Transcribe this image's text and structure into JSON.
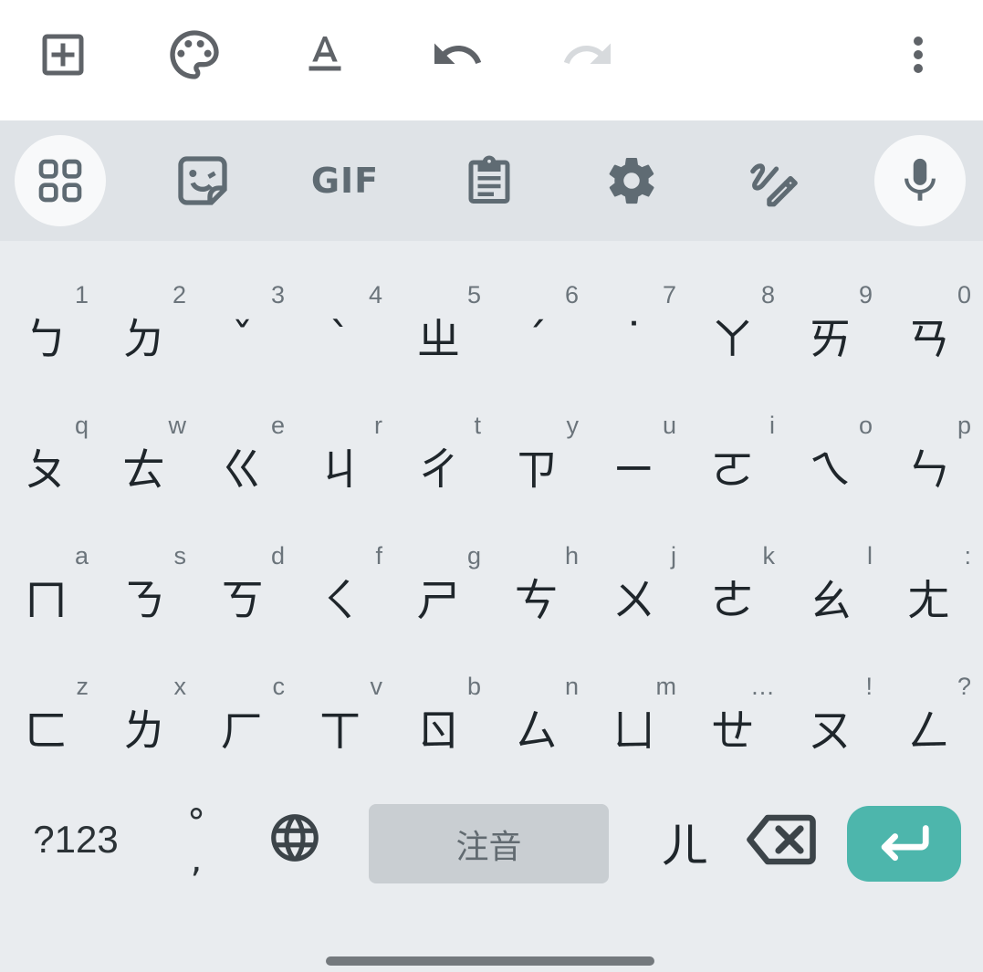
{
  "toolbar": {
    "icons": [
      "add-box-icon",
      "palette-icon",
      "text-format-icon",
      "undo-icon",
      "redo-icon",
      "more-vert-icon"
    ]
  },
  "keyboard_toolbar": {
    "gif_label": "GIF",
    "icons": [
      "apps-grid-icon",
      "sticker-icon",
      "gif-icon",
      "clipboard-icon",
      "settings-gear-icon",
      "handwriting-icon",
      "microphone-icon"
    ]
  },
  "rows": [
    [
      {
        "hint": "1",
        "glyph": "ㄅ"
      },
      {
        "hint": "2",
        "glyph": "ㄉ"
      },
      {
        "hint": "3",
        "glyph": "ˇ"
      },
      {
        "hint": "4",
        "glyph": "ˋ"
      },
      {
        "hint": "5",
        "glyph": "ㄓ"
      },
      {
        "hint": "6",
        "glyph": "ˊ"
      },
      {
        "hint": "7",
        "glyph": "˙"
      },
      {
        "hint": "8",
        "glyph": "ㄚ"
      },
      {
        "hint": "9",
        "glyph": "ㄞ"
      },
      {
        "hint": "0",
        "glyph": "ㄢ"
      }
    ],
    [
      {
        "hint": "q",
        "glyph": "ㄆ"
      },
      {
        "hint": "w",
        "glyph": "ㄊ"
      },
      {
        "hint": "e",
        "glyph": "ㄍ"
      },
      {
        "hint": "r",
        "glyph": "ㄐ"
      },
      {
        "hint": "t",
        "glyph": "ㄔ"
      },
      {
        "hint": "y",
        "glyph": "ㄗ"
      },
      {
        "hint": "u",
        "glyph": "ㄧ"
      },
      {
        "hint": "i",
        "glyph": "ㄛ"
      },
      {
        "hint": "o",
        "glyph": "ㄟ"
      },
      {
        "hint": "p",
        "glyph": "ㄣ"
      }
    ],
    [
      {
        "hint": "a",
        "glyph": "ㄇ"
      },
      {
        "hint": "s",
        "glyph": "ㄋ"
      },
      {
        "hint": "d",
        "glyph": "ㄎ"
      },
      {
        "hint": "f",
        "glyph": "ㄑ"
      },
      {
        "hint": "g",
        "glyph": "ㄕ"
      },
      {
        "hint": "h",
        "glyph": "ㄘ"
      },
      {
        "hint": "j",
        "glyph": "ㄨ"
      },
      {
        "hint": "k",
        "glyph": "ㄜ"
      },
      {
        "hint": "l",
        "glyph": "ㄠ"
      },
      {
        "hint": ":",
        "glyph": "ㄤ"
      }
    ],
    [
      {
        "hint": "z",
        "glyph": "ㄈ"
      },
      {
        "hint": "x",
        "glyph": "ㄌ"
      },
      {
        "hint": "c",
        "glyph": "ㄏ"
      },
      {
        "hint": "v",
        "glyph": "ㄒ"
      },
      {
        "hint": "b",
        "glyph": "ㄖ"
      },
      {
        "hint": "n",
        "glyph": "ㄙ"
      },
      {
        "hint": "m",
        "glyph": "ㄩ"
      },
      {
        "hint": "…",
        "glyph": "ㄝ"
      },
      {
        "hint": "!",
        "glyph": "ㄡ"
      },
      {
        "hint": "?",
        "glyph": "ㄥ"
      }
    ]
  ],
  "bottom": {
    "symbols_label": "?123",
    "punct_top": "°",
    "punct_bottom": ",",
    "space_label": "注音",
    "er_label": "ㄦ",
    "globe_icon": "globe-icon",
    "backspace_icon": "backspace-icon",
    "enter_icon": "enter-return-icon"
  },
  "colors": {
    "accent": "#4db6ac",
    "key_area": "#e9ecef",
    "toolbar_strip": "#dfe3e7",
    "icon": "#5f6b73"
  }
}
